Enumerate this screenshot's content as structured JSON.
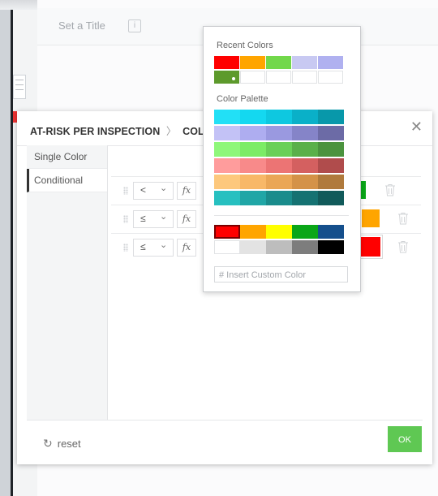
{
  "background": {
    "widget_title": "Set a Title",
    "info_glyph": "i"
  },
  "modal": {
    "title": "AT-RISK PER INSPECTION",
    "breadcrumb_sep": "〉",
    "subtitle": "COLO",
    "close_glyph": "✕",
    "nav": [
      {
        "label": "Single Color",
        "active": false
      },
      {
        "label": "Conditional",
        "active": true
      }
    ],
    "rules": [
      {
        "operator": "<",
        "fx": "fx",
        "color": "#0aa618"
      },
      {
        "operator": "≤",
        "fx": "fx",
        "color": "#ffa500"
      },
      {
        "operator": "≤",
        "fx": "fx",
        "color": "#ff0000"
      }
    ],
    "reset_label": "reset",
    "ok_label": "OK"
  },
  "picker": {
    "recent_label": "Recent Colors",
    "recent_colors": [
      "#ff0000",
      "#ffa500",
      "#72d84b",
      "#c8c9f2",
      "#b0b1f0",
      "#5d9a2c",
      "",
      "",
      "",
      ""
    ],
    "palette_label": "Color Palette",
    "palette": [
      [
        "#22e0f6",
        "#14d8f0",
        "#0ec8e0",
        "#0ab0c8",
        "#0898aa"
      ],
      [
        "#c3c2f6",
        "#aeadf0",
        "#9a99e0",
        "#8584c8",
        "#6c6ba6"
      ],
      [
        "#8ff77a",
        "#7cec66",
        "#6ad058",
        "#5ab04a",
        "#4b933e"
      ],
      [
        "#ff9c9c",
        "#f88a8a",
        "#ec7474",
        "#d46060",
        "#b04c4c"
      ],
      [
        "#fdc87c",
        "#f8b868",
        "#eaa656",
        "#d49248",
        "#b07a3c"
      ],
      [
        "#27c0c0",
        "#20a6a6",
        "#1a8c8c",
        "#157272",
        "#115a5a"
      ]
    ],
    "basic_colors": [
      [
        "#ff0000",
        "#ffa500",
        "#ffff00",
        "#0aa618",
        "#154f8c"
      ],
      [
        "#ffffff",
        "#e3e3e3",
        "#bdbdbd",
        "#7d7d7d",
        "#000000"
      ]
    ],
    "custom_placeholder": "# Insert Custom Color"
  }
}
